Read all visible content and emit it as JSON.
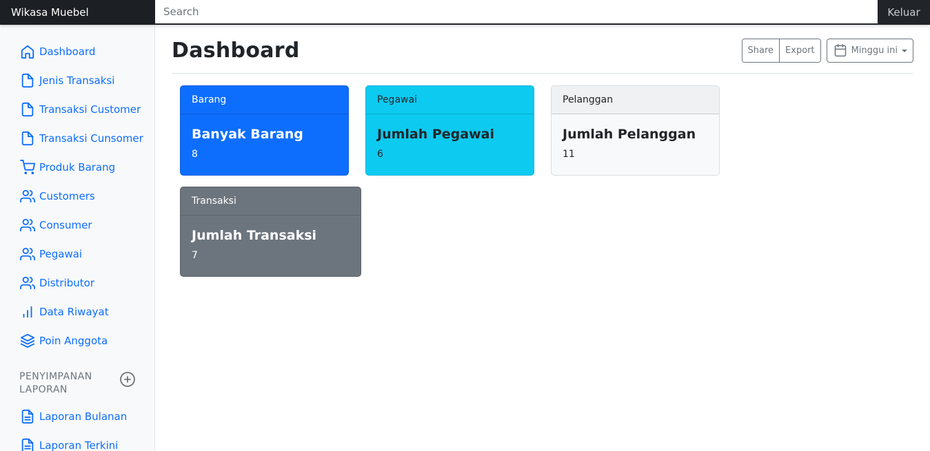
{
  "navbar": {
    "brand": "Wikasa Muebel",
    "search_placeholder": "Search",
    "signout": "Keluar"
  },
  "sidebar": {
    "items": [
      {
        "label": "Dashboard",
        "icon": "home-icon"
      },
      {
        "label": "Jenis Transaksi",
        "icon": "file-icon"
      },
      {
        "label": "Transaksi Customer",
        "icon": "file-icon"
      },
      {
        "label": "Transaksi Cunsomer",
        "icon": "file-icon"
      },
      {
        "label": "Produk Barang",
        "icon": "shopping-cart-icon"
      },
      {
        "label": "Customers",
        "icon": "users-icon"
      },
      {
        "label": "Consumer",
        "icon": "users-icon"
      },
      {
        "label": "Pegawai",
        "icon": "users-icon"
      },
      {
        "label": "Distributor",
        "icon": "users-icon"
      },
      {
        "label": "Data Riwayat",
        "icon": "bar-chart-icon"
      },
      {
        "label": "Poin Anggota",
        "icon": "layers-icon"
      }
    ],
    "section_title": "PENYIMPANAN LAPORAN",
    "reports": [
      {
        "label": "Laporan Bulanan",
        "icon": "file-text-icon"
      },
      {
        "label": "Laporan Terkini",
        "icon": "file-text-icon"
      }
    ]
  },
  "main": {
    "title": "Dashboard",
    "toolbar": {
      "share": "Share",
      "export": "Export",
      "range": "Minggu ini"
    },
    "cards": [
      {
        "header": "Barang",
        "title": "Banyak Barang",
        "value": "8",
        "color": "#0d6efd"
      },
      {
        "header": "Pegawai",
        "title": "Jumlah Pegawai",
        "value": "6",
        "color": "#0dcaf0"
      },
      {
        "header": "Pelanggan",
        "title": "Jumlah Pelanggan",
        "value": "11",
        "color": "#f8f9fa"
      },
      {
        "header": "Transaksi",
        "title": "Jumlah Transaksi",
        "value": "7",
        "color": "#6c757d"
      }
    ]
  }
}
